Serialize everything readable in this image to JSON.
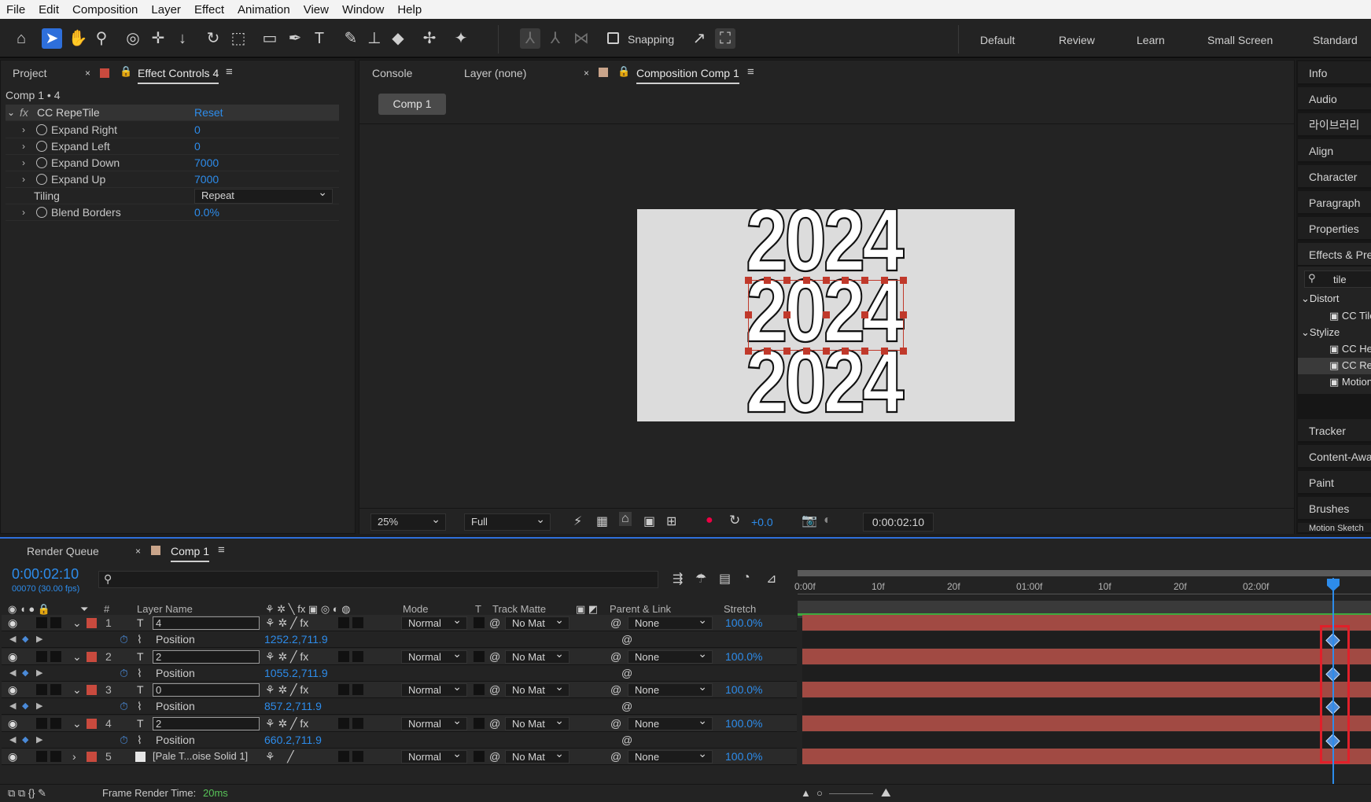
{
  "menu": [
    "File",
    "Edit",
    "Composition",
    "Layer",
    "Effect",
    "Animation",
    "View",
    "Window",
    "Help"
  ],
  "toolbar": {
    "snapping_label": "Snapping",
    "workspaces": [
      "Default",
      "Review",
      "Learn",
      "Small Screen",
      "Standard"
    ]
  },
  "left_panel": {
    "tab_project": "Project",
    "tab_effect_controls": "Effect Controls 4",
    "breadcrumb": "Comp 1 • 4",
    "effect_name": "CC RepeTile",
    "reset_label": "Reset",
    "fx_label": "fx",
    "params": [
      {
        "label": "Expand Right",
        "value": "0"
      },
      {
        "label": "Expand Left",
        "value": "0"
      },
      {
        "label": "Expand Down",
        "value": "7000"
      },
      {
        "label": "Expand Up",
        "value": "7000"
      },
      {
        "label": "Tiling",
        "value": "Repeat"
      },
      {
        "label": "Blend Borders",
        "value": "0.0%"
      }
    ]
  },
  "center_panel": {
    "tab_console": "Console",
    "tab_layer": "Layer (none)",
    "tab_composition": "Composition Comp 1",
    "comp_button": "Comp 1",
    "canvas_text": "2024",
    "zoom": "25%",
    "resolution": "Full",
    "exposure": "+0.0",
    "timecode": "0:00:02:10"
  },
  "right_panel": {
    "items": [
      "Info",
      "Audio",
      "라이브러리",
      "Align",
      "Character",
      "Paragraph",
      "Properties",
      "Effects & Presets"
    ],
    "search_value": "tile",
    "groups": [
      {
        "name": "Distort",
        "items": [
          "CC Tiler"
        ]
      },
      {
        "name": "Stylize",
        "items": [
          "CC HexTile",
          "CC RepeTile",
          "Motion Tile"
        ]
      }
    ],
    "lower_items": [
      "Tracker",
      "Content-Aware Fill",
      "Paint",
      "Brushes",
      "Motion Sketch"
    ]
  },
  "timeline": {
    "tab_render_queue": "Render Queue",
    "tab_comp": "Comp 1",
    "timecode": "0:00:02:10",
    "frame_info": "00070 (30.00 fps)",
    "ruler_labels": [
      "0:00f",
      "10f",
      "20f",
      "01:00f",
      "10f",
      "20f",
      "02:00f"
    ],
    "headers": {
      "num": "#",
      "layer_name": "Layer Name",
      "mode": "Mode",
      "t": "T",
      "track_matte": "Track Matte",
      "parent": "Parent & Link",
      "stretch": "Stretch"
    },
    "layers": [
      {
        "num": "1",
        "name": "4",
        "mode": "Normal",
        "matte": "No Mat",
        "parent": "None",
        "stretch": "100.0%",
        "position": "1252.2,711.9"
      },
      {
        "num": "2",
        "name": "2",
        "mode": "Normal",
        "matte": "No Mat",
        "parent": "None",
        "stretch": "100.0%",
        "position": "1055.2,711.9"
      },
      {
        "num": "3",
        "name": "0",
        "mode": "Normal",
        "matte": "No Mat",
        "parent": "None",
        "stretch": "100.0%",
        "position": "857.2,711.9"
      },
      {
        "num": "4",
        "name": "2",
        "mode": "Normal",
        "matte": "No Mat",
        "parent": "None",
        "stretch": "100.0%",
        "position": "660.2,711.9"
      }
    ],
    "solid_layer": {
      "num": "5",
      "name": "[Pale T...oise Solid 1]",
      "mode": "Normal",
      "matte": "No Mat",
      "parent": "None",
      "stretch": "100.0%"
    },
    "prop_label": "Position",
    "frame_render_label": "Frame Render Time:",
    "frame_render_value": "20ms"
  }
}
